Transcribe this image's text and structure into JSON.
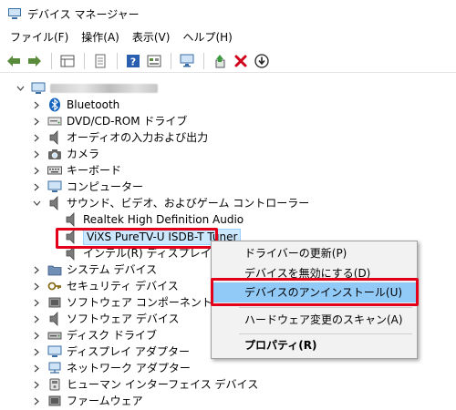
{
  "window": {
    "title": "デバイス マネージャー"
  },
  "menubar": {
    "items": [
      "ファイル(F)",
      "操作(A)",
      "表示(V)",
      "ヘルプ(H)"
    ]
  },
  "toolbar": {
    "buttons": [
      "back-arrow-icon",
      "forward-arrow-icon",
      "properties-grid-icon",
      "document-icon",
      "help-icon",
      "view-grid-icon",
      "monitor-icon",
      "update-driver-icon",
      "remove-x-icon",
      "download-icon"
    ]
  },
  "tree": {
    "root": "",
    "items": [
      {
        "label": "Bluetooth",
        "icon": "bluetooth-icon"
      },
      {
        "label": "DVD/CD-ROM ドライブ",
        "icon": "dvd-drive-icon"
      },
      {
        "label": "オーディオの入力および出力",
        "icon": "speaker-icon"
      },
      {
        "label": "カメラ",
        "icon": "camera-icon"
      },
      {
        "label": "キーボード",
        "icon": "keyboard-icon"
      },
      {
        "label": "コンピューター",
        "icon": "computer-icon"
      },
      {
        "label": "サウンド、ビデオ、およびゲーム コントローラー",
        "icon": "speaker-icon",
        "expanded": true,
        "children": [
          {
            "label": "Realtek High Definition Audio",
            "icon": "speaker-icon"
          },
          {
            "label": "ViXS PureTV-U ISDB-T Tuner",
            "icon": "speaker-icon",
            "selected": true
          },
          {
            "label": "インテル(R) ディスプレイ用オーディオ",
            "icon": "speaker-icon"
          }
        ]
      },
      {
        "label": "システム デバイス",
        "icon": "system-folder-icon"
      },
      {
        "label": "セキュリティ デバイス",
        "icon": "security-key-icon"
      },
      {
        "label": "ソフトウェア コンポーネント",
        "icon": "component-icon"
      },
      {
        "label": "ソフトウェア デバイス",
        "icon": "speaker-icon"
      },
      {
        "label": "ディスク ドライブ",
        "icon": "disk-drive-icon"
      },
      {
        "label": "ディスプレイ アダプター",
        "icon": "display-adapter-icon"
      },
      {
        "label": "ネットワーク アダプター",
        "icon": "network-adapter-icon"
      },
      {
        "label": "ヒューマン インターフェイス デバイス",
        "icon": "hid-icon"
      },
      {
        "label": "ファームウェア",
        "icon": "firmware-icon"
      }
    ]
  },
  "context_menu": {
    "items": [
      {
        "label": "ドライバーの更新(P)"
      },
      {
        "label": "デバイスを無効にする(D)"
      },
      {
        "label": "デバイスのアンインストール(U)",
        "highlighted": true
      },
      {
        "label": "ハードウェア変更のスキャン(A)"
      },
      {
        "label": "プロパティ(R)",
        "bold": true
      }
    ]
  },
  "colors": {
    "highlight_red": "#e3001b",
    "selection_blue": "#cce8ff",
    "menu_hover_blue": "#91c9f7",
    "remove_red": "#d0021b"
  }
}
